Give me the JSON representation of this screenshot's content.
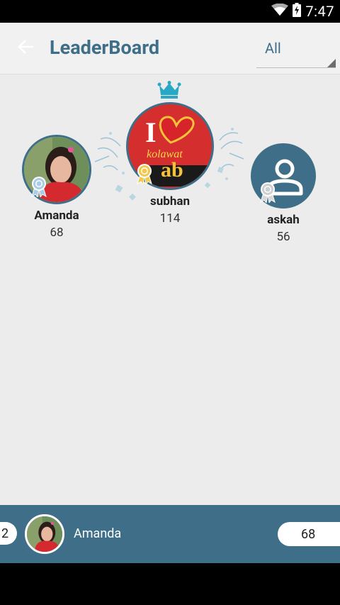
{
  "status_bar": {
    "time": "7:47"
  },
  "toolbar": {
    "title": "LeaderBoard",
    "filter_value": "All"
  },
  "podium": {
    "first": {
      "name": "subhan",
      "score": "114",
      "avatar_text_top": "I",
      "avatar_text_mid": "kolawat",
      "avatar_text_bot": "ab"
    },
    "second": {
      "name": "Amanda",
      "score": "68"
    },
    "third": {
      "name": "askah",
      "score": "56"
    }
  },
  "current_user": {
    "rank": "2",
    "name": "Amanda",
    "score": "68"
  },
  "colors": {
    "accent": "#3e6e88",
    "background": "#ececec"
  }
}
